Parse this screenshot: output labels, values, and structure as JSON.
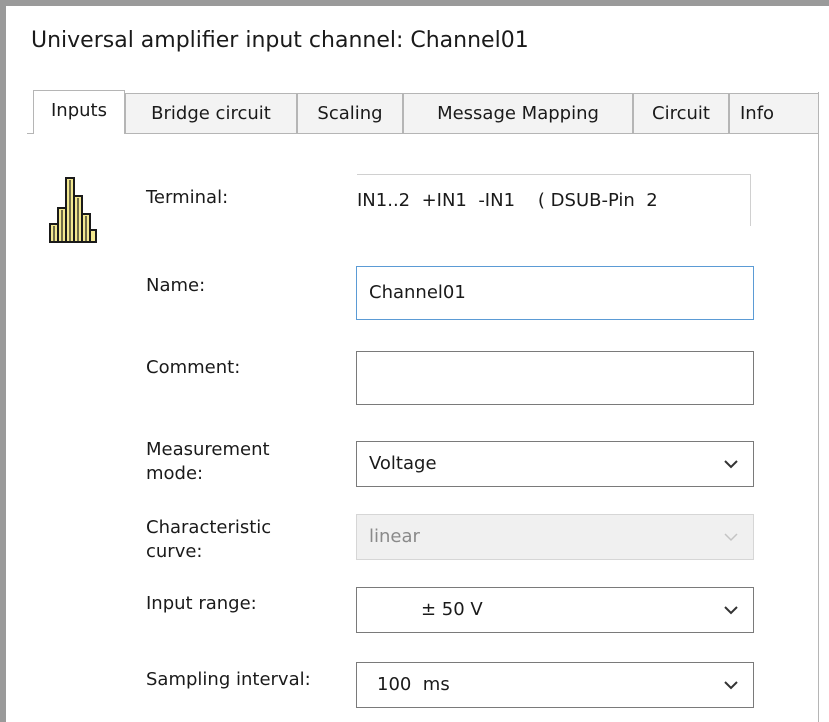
{
  "window": {
    "title": "Universal amplifier input channel: Channel01"
  },
  "tabs": [
    {
      "label": "Inputs",
      "active": true
    },
    {
      "label": "Bridge circuit",
      "active": false
    },
    {
      "label": "Scaling",
      "active": false
    },
    {
      "label": "Message Mapping",
      "active": false
    },
    {
      "label": "Circuit",
      "active": false
    },
    {
      "label": "Info",
      "active": false
    }
  ],
  "icon": {
    "name": "histogram-icon",
    "color": "#f2e890",
    "outline": "#1a1a1a"
  },
  "form": {
    "terminal_label": "Terminal:",
    "terminal_value": "IN1..2  +IN1  -IN1    ( DSUB-Pin  2",
    "name_label": "Name:",
    "name_value": "Channel01",
    "comment_label": "Comment:",
    "comment_value": "",
    "mode_label": "Measurement mode:",
    "mode_value": "Voltage",
    "curve_label": "Characteristic curve:",
    "curve_value": "linear",
    "curve_enabled": false,
    "range_label": "Input range:",
    "range_value": "± 50 V",
    "sampling_label": "Sampling interval:",
    "sampling_value": "100  ms"
  },
  "colors": {
    "focus_border": "#5b9bd5",
    "disabled_text": "#8a8a8a"
  }
}
